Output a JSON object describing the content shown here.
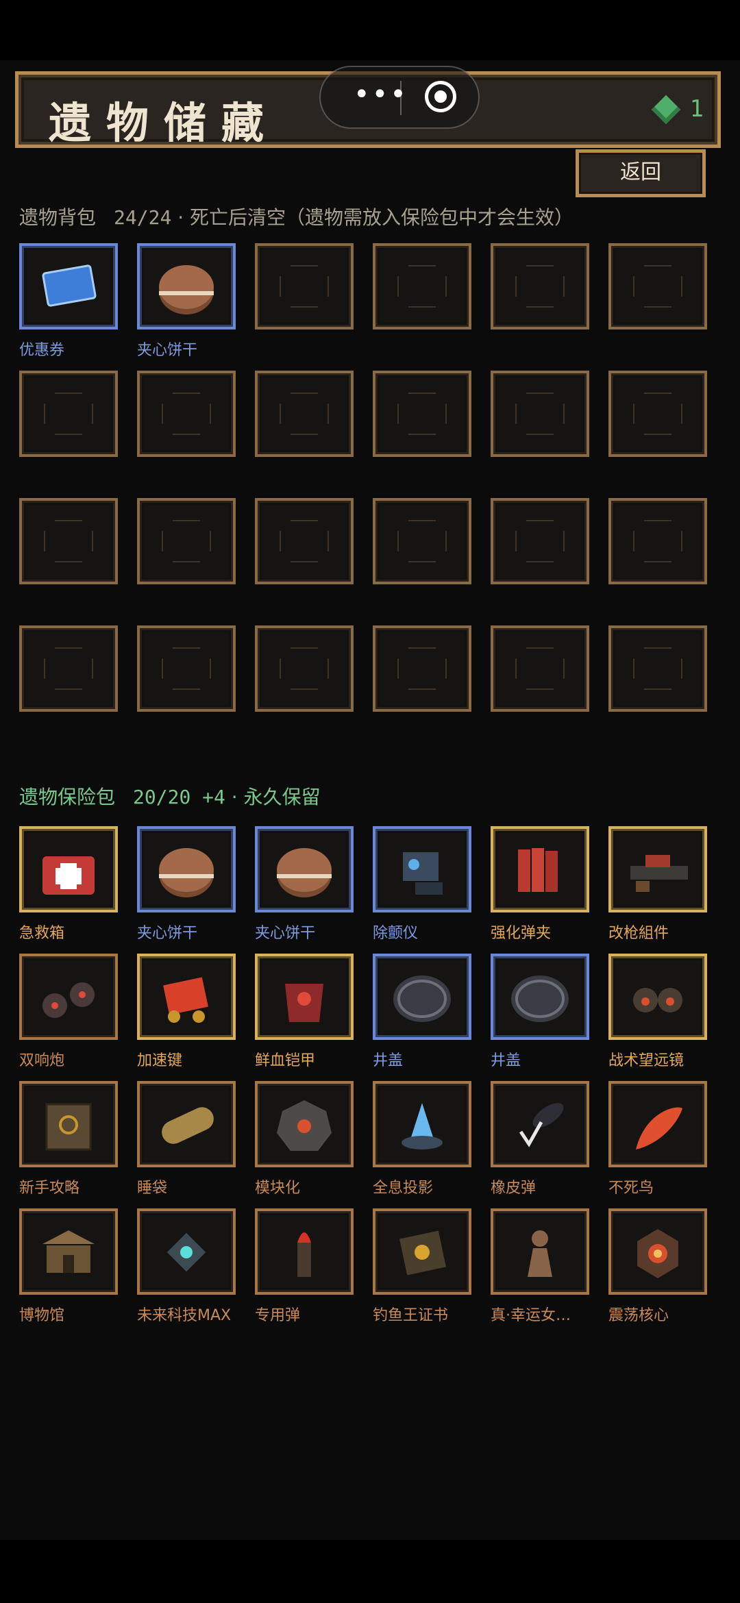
{
  "header": {
    "title": "遗物储藏",
    "gem_count": "1",
    "back_label": "返回"
  },
  "bag": {
    "name": "遗物背包",
    "count": "24/24",
    "note": "· 死亡后清空（遗物需放入保险包中才会生效）",
    "items": [
      {
        "label": "优惠券",
        "rarity": "blue",
        "icon": "coupon-icon"
      },
      {
        "label": "夹心饼干",
        "rarity": "blue",
        "icon": "sandwich-cookie-icon"
      }
    ],
    "empty_slots": 22
  },
  "safe": {
    "name": "遗物保险包",
    "count": "20/20 +4",
    "note": "· 永久保留",
    "items": [
      {
        "label": "急救箱",
        "rarity": "gold",
        "icon": "first-aid-kit-icon"
      },
      {
        "label": "夹心饼干",
        "rarity": "blue",
        "icon": "sandwich-cookie-icon"
      },
      {
        "label": "夹心饼干",
        "rarity": "blue",
        "icon": "sandwich-cookie-icon"
      },
      {
        "label": "除颤仪",
        "rarity": "blue",
        "icon": "defibrillator-icon"
      },
      {
        "label": "强化弹夹",
        "rarity": "gold",
        "icon": "reinforced-magazine-icon"
      },
      {
        "label": "改枪組件",
        "rarity": "gold",
        "icon": "gun-mod-kit-icon"
      },
      {
        "label": "双响炮",
        "rarity": "bronze",
        "icon": "double-firecracker-icon"
      },
      {
        "label": "加速键",
        "rarity": "gold",
        "icon": "speed-up-key-icon"
      },
      {
        "label": "鲜血铠甲",
        "rarity": "gold",
        "icon": "blood-armor-icon"
      },
      {
        "label": "井盖",
        "rarity": "blue",
        "icon": "manhole-cover-icon"
      },
      {
        "label": "井盖",
        "rarity": "blue",
        "icon": "manhole-cover-icon"
      },
      {
        "label": "战术望远镜",
        "rarity": "gold",
        "icon": "binoculars-icon"
      },
      {
        "label": "新手攻略",
        "rarity": "bronze",
        "icon": "guidebook-icon"
      },
      {
        "label": "睡袋",
        "rarity": "bronze",
        "icon": "sleeping-bag-icon"
      },
      {
        "label": "模块化",
        "rarity": "bronze",
        "icon": "modular-core-icon"
      },
      {
        "label": "全息投影",
        "rarity": "bronze",
        "icon": "hologram-icon"
      },
      {
        "label": "橡皮弹",
        "rarity": "bronze",
        "icon": "rubber-bullet-icon"
      },
      {
        "label": "不死鸟",
        "rarity": "bronze",
        "icon": "phoenix-feather-icon"
      },
      {
        "label": "博物馆",
        "rarity": "bronze",
        "icon": "museum-icon"
      },
      {
        "label": "未来科技MAX",
        "rarity": "bronze",
        "icon": "future-tech-icon"
      },
      {
        "label": "专用弹",
        "rarity": "bronze",
        "icon": "special-bullet-icon"
      },
      {
        "label": "钓鱼王证书",
        "rarity": "bronze",
        "icon": "fishing-certificate-icon"
      },
      {
        "label": "真·幸运女…",
        "rarity": "bronze",
        "icon": "lucky-goddess-icon"
      },
      {
        "label": "震荡核心",
        "rarity": "bronze",
        "icon": "shock-core-icon"
      }
    ]
  },
  "colors": {
    "rarity_blue": "#6b88d6",
    "rarity_gold": "#d7b25e",
    "rarity_bronze": "#a97745",
    "safe_label": "#78c98b"
  }
}
